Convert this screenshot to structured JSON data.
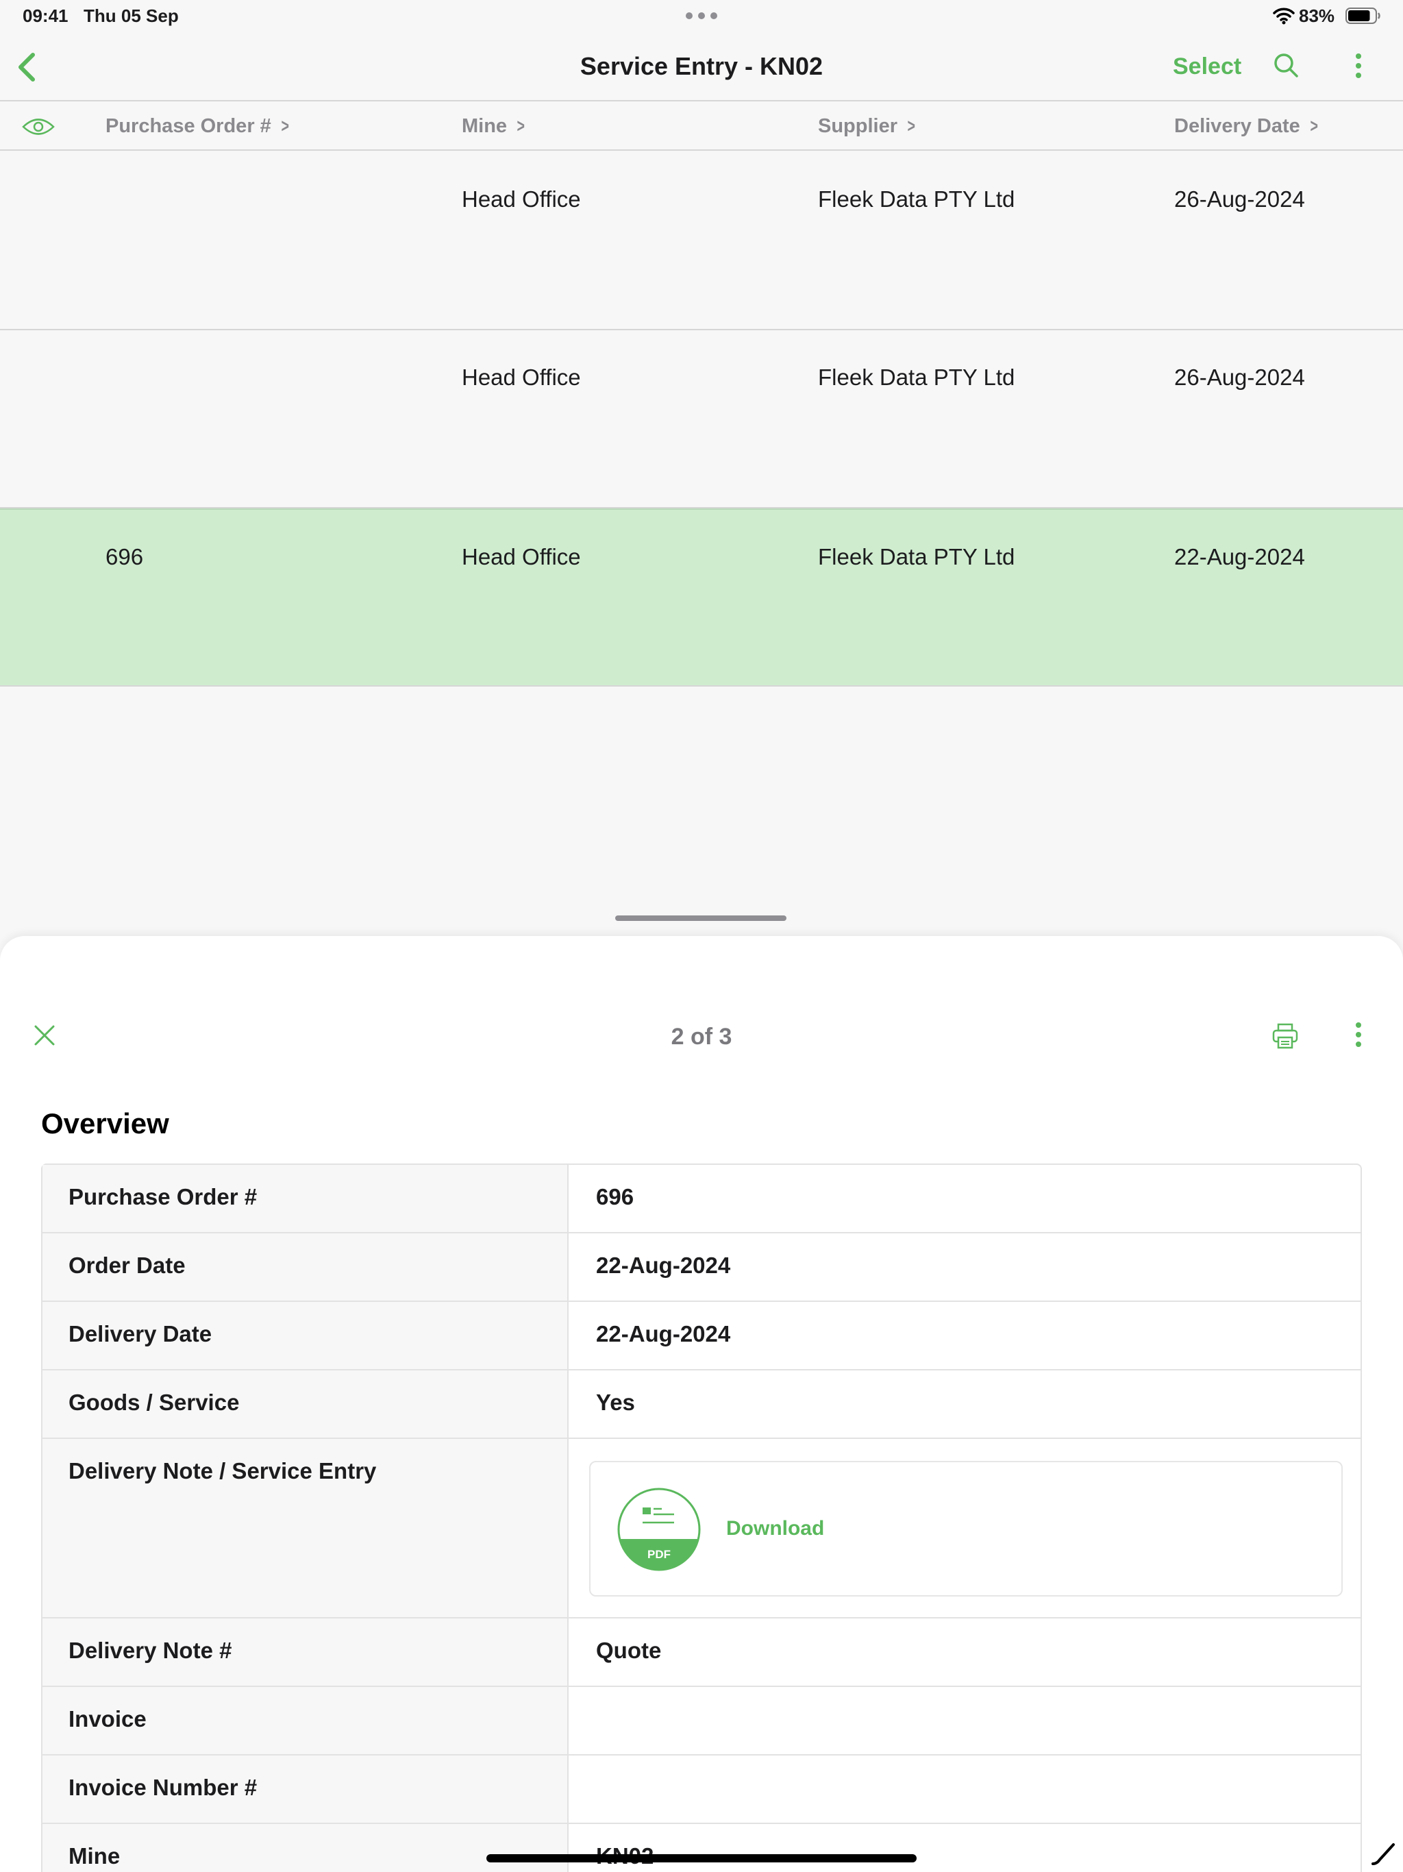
{
  "status_bar": {
    "time": "09:41",
    "date": "Thu 05 Sep",
    "battery_percent": "83%",
    "battery_level": 0.83
  },
  "nav": {
    "title": "Service Entry - KN02",
    "select_label": "Select",
    "icons": [
      "chevron-left-icon",
      "search-icon",
      "more-vertical-icon"
    ],
    "accent_color": "#5ab85c"
  },
  "table": {
    "columns": [
      "Purchase Order #",
      "Mine",
      "Supplier",
      "Delivery Date"
    ],
    "rows": [
      {
        "po": "",
        "mine": "Head Office",
        "supplier": "Fleek Data PTY Ltd",
        "delivery_date": "26-Aug-2024",
        "selected": false
      },
      {
        "po": "",
        "mine": "Head Office",
        "supplier": "Fleek Data PTY Ltd",
        "delivery_date": "26-Aug-2024",
        "selected": false
      },
      {
        "po": "696",
        "mine": "Head Office",
        "supplier": "Fleek Data PTY Ltd",
        "delivery_date": "22-Aug-2024",
        "selected": true
      }
    ],
    "selected_row_color": "#cfeccf"
  },
  "sheet": {
    "pager": "2 of 3",
    "section_title": "Overview",
    "fields": [
      {
        "label": "Purchase Order #",
        "value": "696"
      },
      {
        "label": "Order Date",
        "value": "22-Aug-2024"
      },
      {
        "label": "Delivery Date",
        "value": "22-Aug-2024"
      },
      {
        "label": "Goods / Service",
        "value": "Yes"
      },
      {
        "label": "Delivery Note / Service Entry",
        "value": ""
      },
      {
        "label": "Delivery Note #",
        "value": "Quote"
      },
      {
        "label": "Invoice",
        "value": ""
      },
      {
        "label": "Invoice Number #",
        "value": ""
      },
      {
        "label": "Mine",
        "value": "KN02"
      }
    ],
    "attachment": {
      "badge": "PDF",
      "action_label": "Download"
    }
  }
}
